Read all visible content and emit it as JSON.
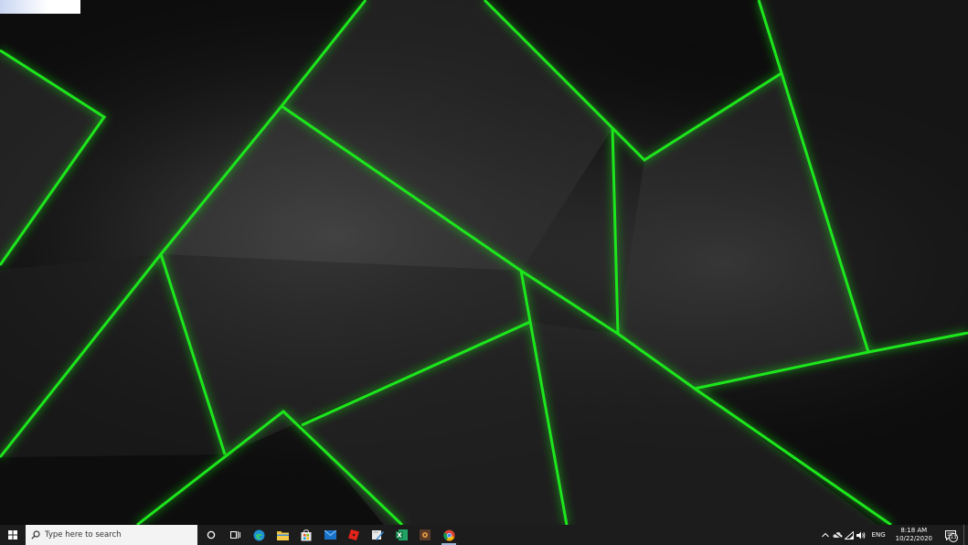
{
  "colors": {
    "accent_green": "#1fe61a",
    "taskbar_bg": "#1c1c1c",
    "search_bg": "#f3f3f3"
  },
  "taskbar": {
    "search_placeholder": "Type here to search",
    "apps": [
      {
        "name": "cortana-icon"
      },
      {
        "name": "task-view-icon"
      },
      {
        "name": "edge-icon"
      },
      {
        "name": "file-explorer-icon"
      },
      {
        "name": "store-icon"
      },
      {
        "name": "mail-icon"
      },
      {
        "name": "roblox-icon"
      },
      {
        "name": "snip-sketch-icon"
      },
      {
        "name": "excel-icon"
      },
      {
        "name": "media-app-icon"
      },
      {
        "name": "chrome-icon"
      }
    ]
  },
  "tray": {
    "language": "ENG",
    "time": "8:18 AM",
    "date": "10/22/2020",
    "notification_count": "13"
  }
}
